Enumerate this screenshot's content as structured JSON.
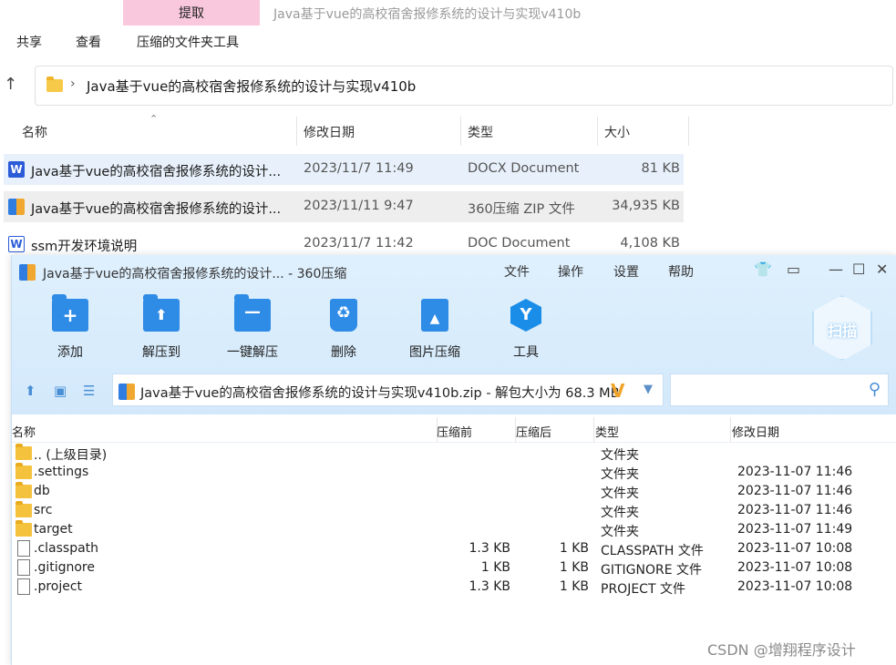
{
  "explorer": {
    "tab_extract": "提取",
    "window_title": "Java基于vue的高校宿舍报修系统的设计与实现v410b",
    "ribbon": [
      "共享",
      "查看",
      "压缩的文件夹工具"
    ],
    "address": "Java基于vue的高校宿舍报修系统的设计与实现v410b",
    "columns": {
      "name": "名称",
      "date": "修改日期",
      "type": "类型",
      "size": "大小"
    },
    "files": [
      {
        "name": "Java基于vue的高校宿舍报修系统的设计...",
        "date": "2023/11/7 11:49",
        "type": "DOCX Document",
        "size": "81 KB",
        "icon": "word-icon"
      },
      {
        "name": "Java基于vue的高校宿舍报修系统的设计...",
        "date": "2023/11/11 9:47",
        "type": "360压缩 ZIP 文件",
        "size": "34,935 KB",
        "icon": "zip-icon"
      },
      {
        "name": "ssm开发环境说明",
        "date": "2023/11/7 11:42",
        "type": "DOC Document",
        "size": "4,108 KB",
        "icon": "word-doc-icon"
      }
    ]
  },
  "zip": {
    "title": "Java基于vue的高校宿舍报修系统的设计... - 360压缩",
    "menu": [
      "文件",
      "操作",
      "设置",
      "帮助"
    ],
    "tools": [
      "添加",
      "解压到",
      "一键解压",
      "删除",
      "图片压缩",
      "工具"
    ],
    "scan_label": "扫描",
    "path": "Java基于vue的高校宿舍报修系统的设计与实现v410b.zip - 解包大小为 68.3 MB",
    "search_placeholder": "",
    "columns": {
      "name": "名称",
      "before": "压缩前",
      "after": "压缩后",
      "type": "类型",
      "date": "修改日期"
    },
    "rows": [
      {
        "name": ".. (上级目录)",
        "before": "",
        "after": "",
        "type": "文件夹",
        "date": "",
        "kind": "folder"
      },
      {
        "name": ".settings",
        "before": "",
        "after": "",
        "type": "文件夹",
        "date": "2023-11-07 11:46",
        "kind": "folder"
      },
      {
        "name": "db",
        "before": "",
        "after": "",
        "type": "文件夹",
        "date": "2023-11-07 11:46",
        "kind": "folder"
      },
      {
        "name": "src",
        "before": "",
        "after": "",
        "type": "文件夹",
        "date": "2023-11-07 11:46",
        "kind": "folder"
      },
      {
        "name": "target",
        "before": "",
        "after": "",
        "type": "文件夹",
        "date": "2023-11-07 11:49",
        "kind": "folder"
      },
      {
        "name": ".classpath",
        "before": "1.3 KB",
        "after": "1 KB",
        "type": "CLASSPATH 文件",
        "date": "2023-11-07 10:08",
        "kind": "file"
      },
      {
        "name": ".gitignore",
        "before": "1 KB",
        "after": "1 KB",
        "type": "GITIGNORE 文件",
        "date": "2023-11-07 10:08",
        "kind": "file"
      },
      {
        "name": ".project",
        "before": "1.3 KB",
        "after": "1 KB",
        "type": "PROJECT 文件",
        "date": "2023-11-07 10:08",
        "kind": "file"
      }
    ]
  },
  "watermark": "CSDN @增翔程序设计"
}
